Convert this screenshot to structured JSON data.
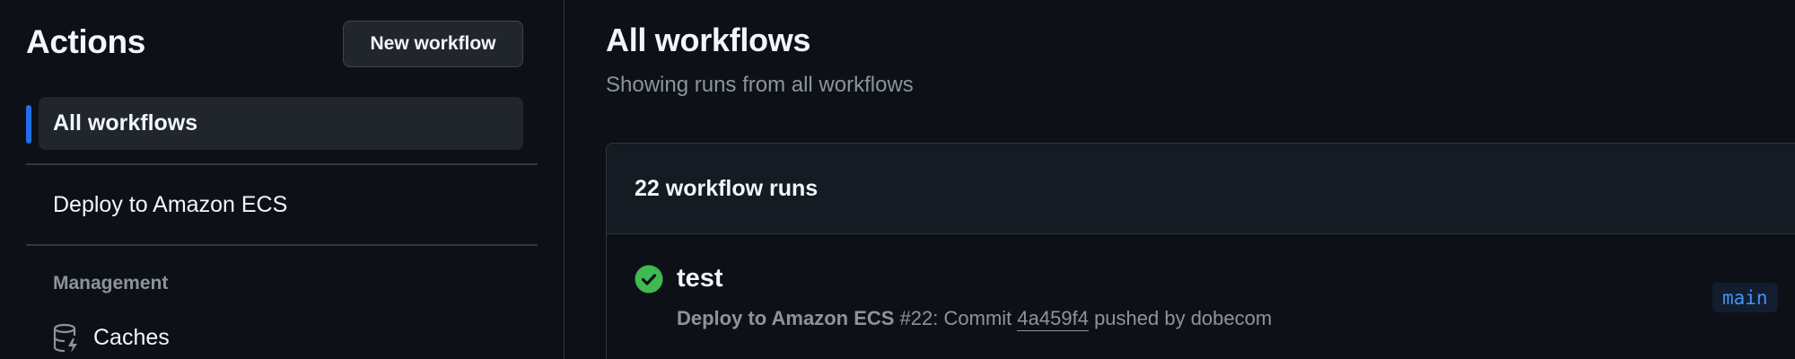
{
  "sidebar": {
    "title": "Actions",
    "new_workflow_label": "New workflow",
    "items": [
      {
        "label": "All workflows",
        "active": true
      },
      {
        "label": "Deploy to Amazon ECS",
        "active": false
      }
    ],
    "management": {
      "label": "Management",
      "items": [
        {
          "label": "Caches",
          "icon": "database-icon"
        }
      ]
    }
  },
  "main": {
    "title": "All workflows",
    "subtitle": "Showing runs from all workflows",
    "runs": {
      "count_label": "22 workflow runs",
      "items": [
        {
          "status": "success",
          "status_icon": "check-circle-icon",
          "title": "test",
          "workflow": "Deploy to Amazon ECS",
          "run_number": "#22",
          "commit_prefix": ": Commit",
          "commit": "4a459f4",
          "pushed_by": "pushed by dobecom",
          "branch": "main"
        }
      ]
    }
  },
  "colors": {
    "background": "#0d1117",
    "accent": "#1f6feb",
    "success": "#3fb950",
    "branch_text": "#4493f8",
    "muted_text": "#8b949e"
  }
}
